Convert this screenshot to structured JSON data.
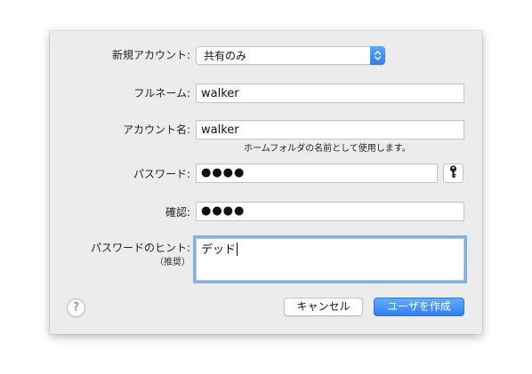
{
  "form": {
    "account_type": {
      "label": "新規アカウント:",
      "value": "共有のみ"
    },
    "full_name": {
      "label": "フルネーム:",
      "value": "walker"
    },
    "account_name": {
      "label": "アカウント名:",
      "value": "walker",
      "note": "ホームフォルダの名前として使用します。"
    },
    "password": {
      "label": "パスワード:",
      "masked": "●●●●"
    },
    "verify": {
      "label": "確認:",
      "masked": "●●●●"
    },
    "hint": {
      "label": "パスワードのヒント:",
      "sublabel": "（推奨）",
      "value": "デッド"
    }
  },
  "buttons": {
    "help": "?",
    "cancel": "キャンセル",
    "create": "ユーザを作成"
  },
  "icons": {
    "popup_arrows": "chevron-updown-icon",
    "password_assistant": "key-icon"
  },
  "colors": {
    "accent": "#3a8cf7",
    "focus_ring": "#5c9cf0",
    "sheet_background": "#ececec"
  }
}
